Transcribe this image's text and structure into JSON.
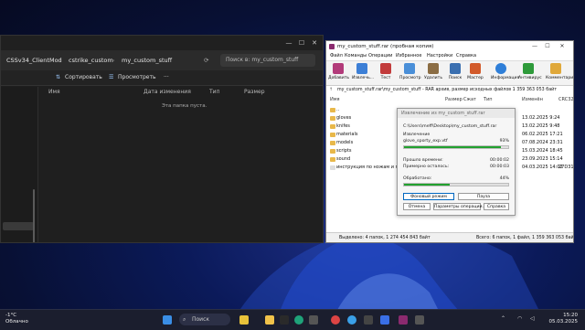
{
  "explorer": {
    "breadcrumbs": [
      "CSSv34_ClientMod",
      "cstrike_custom",
      "my_custom_stuff"
    ],
    "search_placeholder": "Поиск в: my_custom_stuff",
    "sort_label": "Сортировать",
    "view_label": "Просмотреть",
    "more_label": "···",
    "columns": [
      "Имя",
      "Дата изменения",
      "Тип",
      "Размер"
    ],
    "empty_text": "Эта папка пуста.",
    "win_min": "—",
    "win_max": "☐",
    "win_close": "✕"
  },
  "winrar": {
    "title": "my_custom_stuff.rar (пробная копия)",
    "menu": [
      "Файл",
      "Команды",
      "Операции",
      "Избранное",
      "Настройки",
      "Справка"
    ],
    "toolbar": [
      "Добавить",
      "Извлечь...",
      "Тест",
      "Просмотр",
      "Удалить",
      "Поиск",
      "Мастер",
      "Информация",
      "Антивирус",
      "Комментарий"
    ],
    "path_text": "my_custom_stuff.rar\\my_custom_stuff - RAR архив, размер исходных файлов 1 359 363 053 байт",
    "columns": [
      "Имя",
      "Размер",
      "Сжат",
      "Тип",
      "Изменён",
      "CRC32"
    ],
    "rows": [
      {
        "name": "..",
        "date": "",
        "crc": ""
      },
      {
        "name": "gloves",
        "date": "13.02.2025 9:24",
        "crc": ""
      },
      {
        "name": "knifes",
        "date": "13.02.2025 9:48",
        "crc": ""
      },
      {
        "name": "materials",
        "date": "06.02.2025 17:21",
        "crc": ""
      },
      {
        "name": "models",
        "date": "07.08.2024 23:31",
        "crc": ""
      },
      {
        "name": "scripts",
        "date": "15.03.2024 18:45",
        "crc": ""
      },
      {
        "name": "sound",
        "date": "23.09.2023 15:14",
        "crc": ""
      },
      {
        "name": "инструкция по ножам и перча...",
        "date": "04.03.2025 14:02",
        "crc": "27D3188E"
      }
    ],
    "status_left": "Выделено: 4 папок, 1 274 454 843 байт",
    "status_right": "Всего: 6 папок, 1 файл, 1 359 363 053 байт"
  },
  "dialog": {
    "title": "Извлечение из my_custom_stuff.rar",
    "archive_path": "C:\\Users\\meff\\Desktop\\my_custom_stuff.rar",
    "extract_label": "Извлечение",
    "file_name": "glove_sporty_exp.vtf",
    "file_percent": "93%",
    "file_progress": 0.93,
    "elapsed_label": "Прошло времени:",
    "elapsed_value": "00:00:02",
    "remaining_label": "Примерно осталось:",
    "remaining_value": "00:00:03",
    "processed_label": "Обработано:",
    "processed_percent": "44%",
    "processed_progress": 0.44,
    "btn_background": "Фоновый режим",
    "btn_pause": "Пауза",
    "btn_cancel": "Отмена",
    "btn_params": "Параметры операции...",
    "btn_help": "Справка"
  },
  "taskbar": {
    "temp": "-1°C",
    "weather": "Облачно",
    "search": "Поиск",
    "time": "15:20",
    "date": "05.03.2025"
  }
}
